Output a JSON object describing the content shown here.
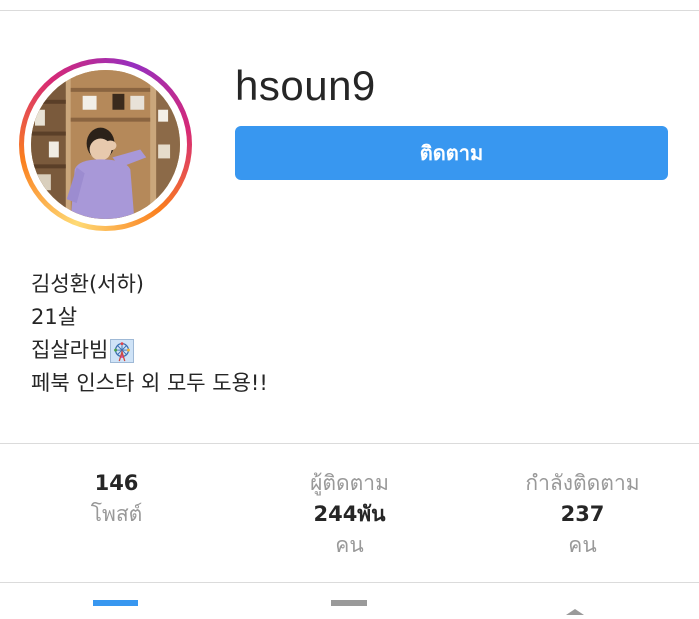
{
  "profile": {
    "username": "hsoun9",
    "follow_label": "ติดตาม"
  },
  "bio": {
    "lines": [
      "김성환(서하)",
      "21살",
      "집살라빔",
      "페북 인스타 외 모두 도용!!"
    ],
    "emoji_icon": "ferris-wheel-icon"
  },
  "stats": {
    "posts": {
      "value": "146",
      "label": "โพสต์"
    },
    "followers": {
      "value": "244พัน",
      "label_top": "ผู้ติดตาม",
      "label_bottom": "คน"
    },
    "following": {
      "value": "237",
      "label_top": "กำลังติดตาม",
      "label_bottom": "คน"
    }
  },
  "tabs": [
    {
      "icon": "grid-icon",
      "active": true
    },
    {
      "icon": "list-icon",
      "active": false
    },
    {
      "icon": "tagged-icon",
      "active": false
    }
  ],
  "colors": {
    "accent": "#3897f0",
    "text": "#262626",
    "muted": "#999999",
    "divider": "#dbdbdb"
  }
}
